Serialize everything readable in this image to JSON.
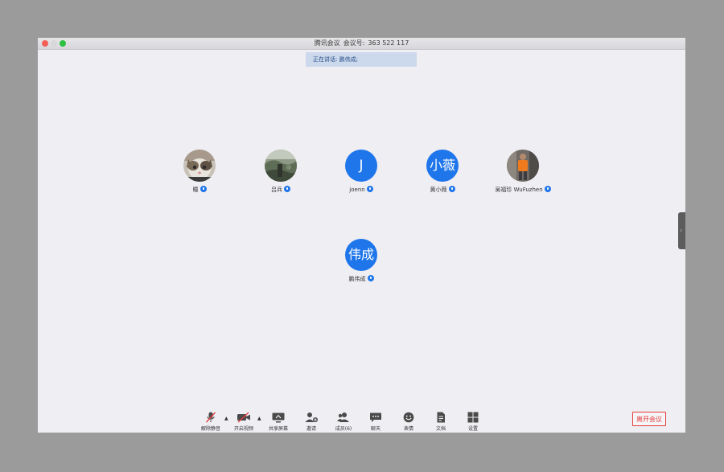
{
  "window": {
    "title_app": "腾讯会议",
    "title_id_label": "会议号:",
    "title_id": "363 522 117"
  },
  "speaker": {
    "label": "正在讲话: 鹏伟成;"
  },
  "participants": [
    {
      "name": "瞳",
      "avatar": "cat-photo"
    },
    {
      "name": "吕兵",
      "avatar": "landscape-photo"
    },
    {
      "name": "joenn",
      "avatar_text": "J"
    },
    {
      "name": "黄小薇",
      "avatar_text": "小薇"
    },
    {
      "name": "吴福珍 WuFuzhen",
      "avatar": "person-photo"
    },
    {
      "name": "鹏伟成",
      "avatar_text": "伟成"
    }
  ],
  "toolbar": {
    "unmute": "解除静音",
    "start_video": "开启视频",
    "share_screen": "共享屏幕",
    "invite": "邀请",
    "members": "成员(6)",
    "chat": "聊天",
    "emoji": "表情",
    "docs": "文档",
    "settings": "设置",
    "leave": "离开会议"
  },
  "colors": {
    "accent": "#1f76eb",
    "danger": "#e53b3b",
    "background": "#efeef2",
    "banner": "#ccd9ec"
  }
}
